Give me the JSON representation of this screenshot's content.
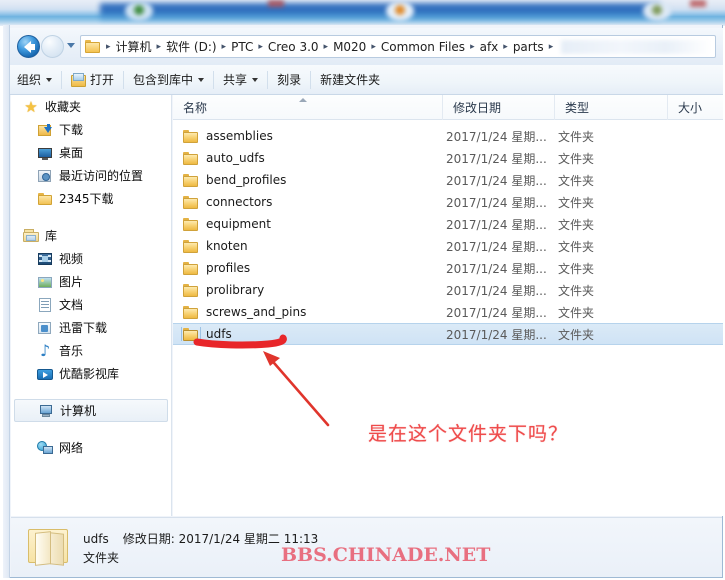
{
  "window": {
    "nav": {
      "back_label": "back-arrow",
      "forward_label": "forward-arrow",
      "recent_dropdown_label": "recent-locations"
    },
    "breadcrumb": {
      "folder_icon": "folder-icon",
      "separator": "▸",
      "items": [
        {
          "label": "计算机"
        },
        {
          "label": "软件 (D:)"
        },
        {
          "label": "PTC"
        },
        {
          "label": "Creo 3.0"
        },
        {
          "label": "M020"
        },
        {
          "label": "Common Files"
        },
        {
          "label": "afx"
        },
        {
          "label": "parts"
        }
      ]
    },
    "toolbar": {
      "organize": "组织",
      "open": "打开",
      "include_in_library": "包含到库中",
      "share": "共享",
      "burn": "刻录",
      "new_folder": "新建文件夹"
    }
  },
  "sidebar": {
    "groups": [
      {
        "name": "favorites",
        "label": "收藏夹",
        "icon": "star-icon",
        "items": [
          {
            "label": "下载",
            "icon": "downloads-icon"
          },
          {
            "label": "桌面",
            "icon": "desktop-icon"
          },
          {
            "label": "最近访问的位置",
            "icon": "recent-places-icon"
          },
          {
            "label": "2345下载",
            "icon": "folder-icon"
          }
        ]
      },
      {
        "name": "libraries",
        "label": "库",
        "icon": "library-icon",
        "items": [
          {
            "label": "视频",
            "icon": "video-icon"
          },
          {
            "label": "图片",
            "icon": "picture-icon"
          },
          {
            "label": "文档",
            "icon": "document-icon"
          },
          {
            "label": "迅雷下载",
            "icon": "thunder-download-icon"
          },
          {
            "label": "音乐",
            "icon": "music-icon"
          },
          {
            "label": "优酷影视库",
            "icon": "youku-icon"
          }
        ]
      }
    ],
    "computer": {
      "label": "计算机",
      "icon": "computer-icon",
      "selected": true
    },
    "network": {
      "label": "网络",
      "icon": "network-icon"
    }
  },
  "filelist": {
    "columns": [
      {
        "key": "name",
        "label": "名称",
        "sorted": "asc"
      },
      {
        "key": "date",
        "label": "修改日期"
      },
      {
        "key": "type",
        "label": "类型"
      },
      {
        "key": "size",
        "label": "大小"
      }
    ],
    "rows": [
      {
        "name": "assemblies",
        "date": "2017/1/24 星期...",
        "type": "文件夹",
        "size": "",
        "icon": "folder-icon",
        "selected": false
      },
      {
        "name": "auto_udfs",
        "date": "2017/1/24 星期...",
        "type": "文件夹",
        "size": "",
        "icon": "folder-icon",
        "selected": false
      },
      {
        "name": "bend_profiles",
        "date": "2017/1/24 星期...",
        "type": "文件夹",
        "size": "",
        "icon": "folder-icon",
        "selected": false
      },
      {
        "name": "connectors",
        "date": "2017/1/24 星期...",
        "type": "文件夹",
        "size": "",
        "icon": "folder-icon",
        "selected": false
      },
      {
        "name": "equipment",
        "date": "2017/1/24 星期...",
        "type": "文件夹",
        "size": "",
        "icon": "folder-icon",
        "selected": false
      },
      {
        "name": "knoten",
        "date": "2017/1/24 星期...",
        "type": "文件夹",
        "size": "",
        "icon": "folder-icon",
        "selected": false
      },
      {
        "name": "profiles",
        "date": "2017/1/24 星期...",
        "type": "文件夹",
        "size": "",
        "icon": "folder-icon",
        "selected": false
      },
      {
        "name": "prolibrary",
        "date": "2017/1/24 星期...",
        "type": "文件夹",
        "size": "",
        "icon": "folder-icon",
        "selected": false
      },
      {
        "name": "screws_and_pins",
        "date": "2017/1/24 星期...",
        "type": "文件夹",
        "size": "",
        "icon": "folder-icon",
        "selected": false
      },
      {
        "name": "udfs",
        "date": "2017/1/24 星期...",
        "type": "文件夹",
        "size": "",
        "icon": "folder-icon",
        "selected": true
      }
    ]
  },
  "annotation": {
    "text": "是在这个文件夹下吗？",
    "color": "#ef4b4b",
    "arrow": "red-arrow",
    "underline": "red-underline"
  },
  "statusbar": {
    "icon": "folder-large-icon",
    "name": "udfs",
    "date_label": "修改日期:",
    "date_value": "2017/1/24 星期二 11:13",
    "type": "文件夹"
  },
  "watermark": {
    "text": "BBS.CHINADE.NET",
    "color": "#e8697a"
  }
}
